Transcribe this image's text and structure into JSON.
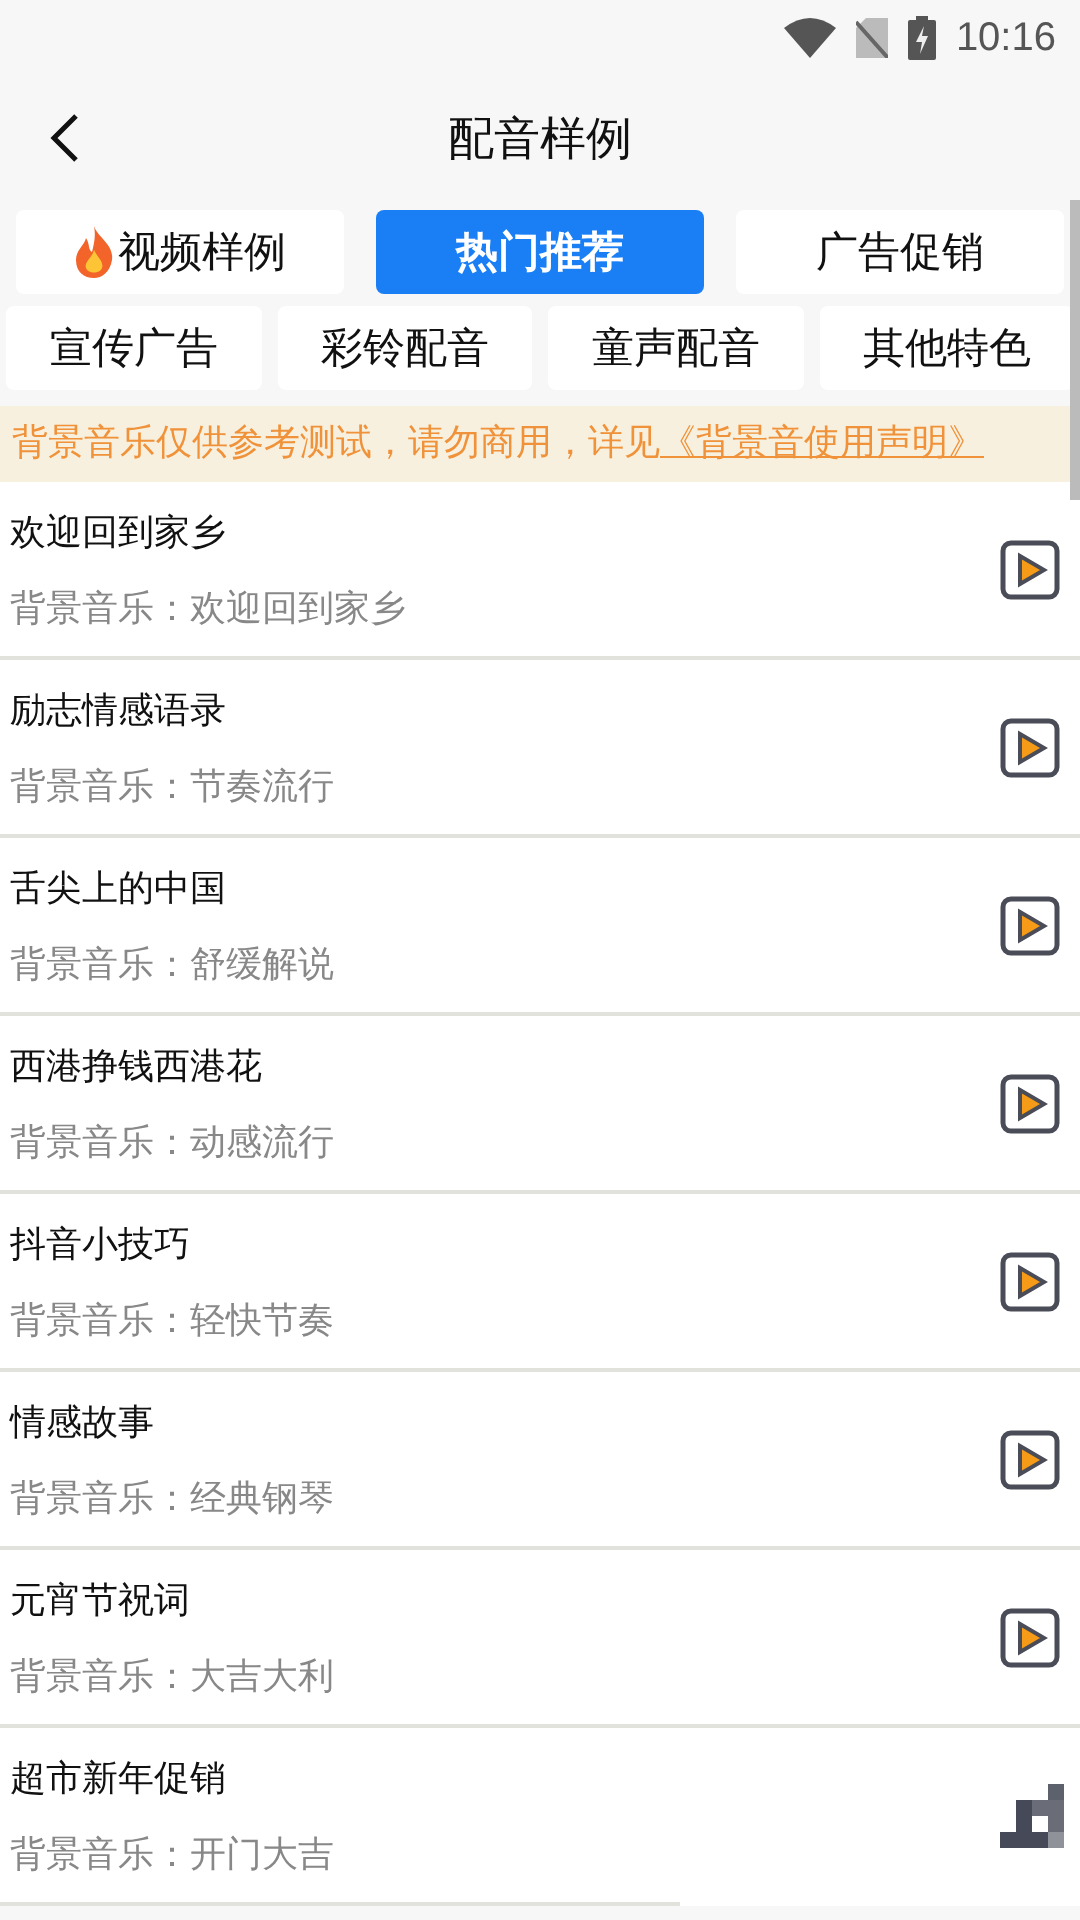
{
  "status_bar": {
    "time": "10:16"
  },
  "header": {
    "title": "配音样例"
  },
  "tab_rows": [
    [
      {
        "label": "视频样例",
        "selected": false,
        "hot": true
      },
      {
        "label": "热门推荐",
        "selected": true,
        "hot": false
      },
      {
        "label": "广告促销",
        "selected": false,
        "hot": false
      }
    ],
    [
      {
        "label": "宣传广告",
        "selected": false,
        "hot": false
      },
      {
        "label": "彩铃配音",
        "selected": false,
        "hot": false
      },
      {
        "label": "童声配音",
        "selected": false,
        "hot": false
      },
      {
        "label": "其他特色",
        "selected": false,
        "hot": false
      }
    ]
  ],
  "notice": {
    "text": "背景音乐仅供参考测试，请勿商用，详见",
    "link": "《背景音使用声明》"
  },
  "samples": [
    {
      "title": "欢迎回到家乡",
      "music": "背景音乐：欢迎回到家乡",
      "kind": "play"
    },
    {
      "title": "励志情感语录",
      "music": "背景音乐：节奏流行",
      "kind": "play"
    },
    {
      "title": "舌尖上的中国",
      "music": "背景音乐：舒缓解说",
      "kind": "play"
    },
    {
      "title": "西港挣钱西港花",
      "music": "背景音乐：动感流行",
      "kind": "play"
    },
    {
      "title": "抖音小技巧",
      "music": "背景音乐：轻快节奏",
      "kind": "play"
    },
    {
      "title": "情感故事",
      "music": "背景音乐：经典钢琴",
      "kind": "play"
    },
    {
      "title": "元宵节祝词",
      "music": "背景音乐：大吉大利",
      "kind": "play"
    },
    {
      "title": "超市新年促销",
      "music": "背景音乐：开门大吉",
      "kind": "loading"
    }
  ]
}
